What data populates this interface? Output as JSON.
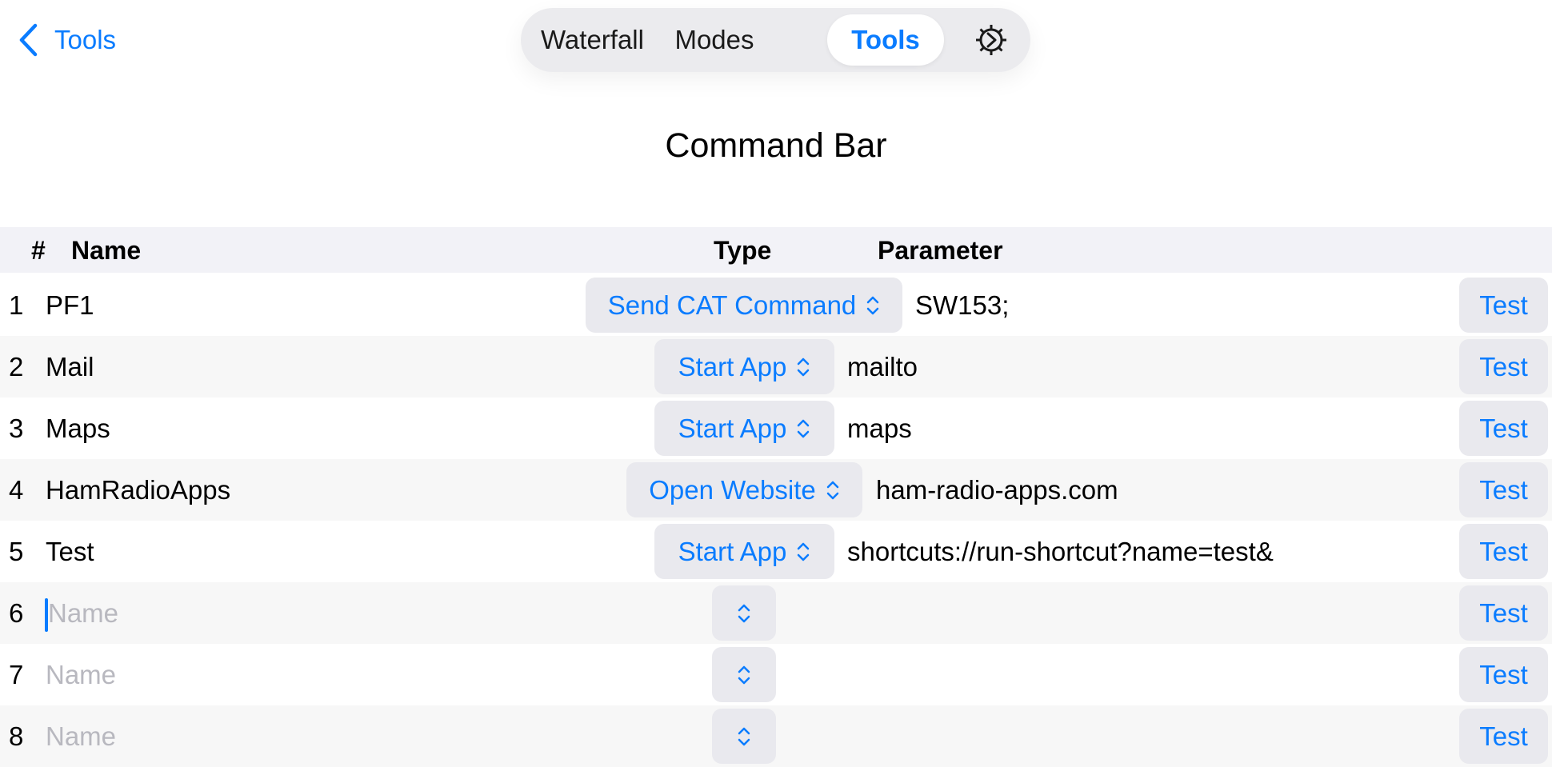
{
  "nav": {
    "back_label": "Tools"
  },
  "segments": [
    {
      "label": "Waterfall"
    },
    {
      "label": "Modes"
    },
    {
      "label": "Tools",
      "active": true
    }
  ],
  "settings_icon": "gear-icon",
  "page_title": "Command Bar",
  "table": {
    "headers": {
      "num": "#",
      "name": "Name",
      "type": "Type",
      "parameter": "Parameter"
    },
    "rows": [
      {
        "num": "1",
        "name": "PF1",
        "type": "Send CAT Command",
        "parameter": "SW153;",
        "test": "Test"
      },
      {
        "num": "2",
        "name": "Mail",
        "type": "Start App",
        "parameter": "mailto",
        "test": "Test"
      },
      {
        "num": "3",
        "name": "Maps",
        "type": "Start App",
        "parameter": "maps",
        "test": "Test"
      },
      {
        "num": "4",
        "name": "HamRadioApps",
        "type": "Open Website",
        "parameter": "ham-radio-apps.com",
        "test": "Test"
      },
      {
        "num": "5",
        "name": "Test",
        "type": "Start App",
        "parameter": "shortcuts://run-shortcut?name=test&",
        "test": "Test"
      },
      {
        "num": "6",
        "name": "",
        "name_placeholder": "Name",
        "type": "",
        "parameter": "",
        "test": "Test",
        "focused": true
      },
      {
        "num": "7",
        "name": "",
        "name_placeholder": "Name",
        "type": "",
        "parameter": "",
        "test": "Test"
      },
      {
        "num": "8",
        "name": "",
        "name_placeholder": "Name",
        "type": "",
        "parameter": "",
        "test": "Test"
      }
    ]
  },
  "colors": {
    "accent": "#0a7cff",
    "header_bg": "#f2f2f7",
    "button_bg": "#e9e9ee",
    "placeholder": "#b8b8bf"
  }
}
